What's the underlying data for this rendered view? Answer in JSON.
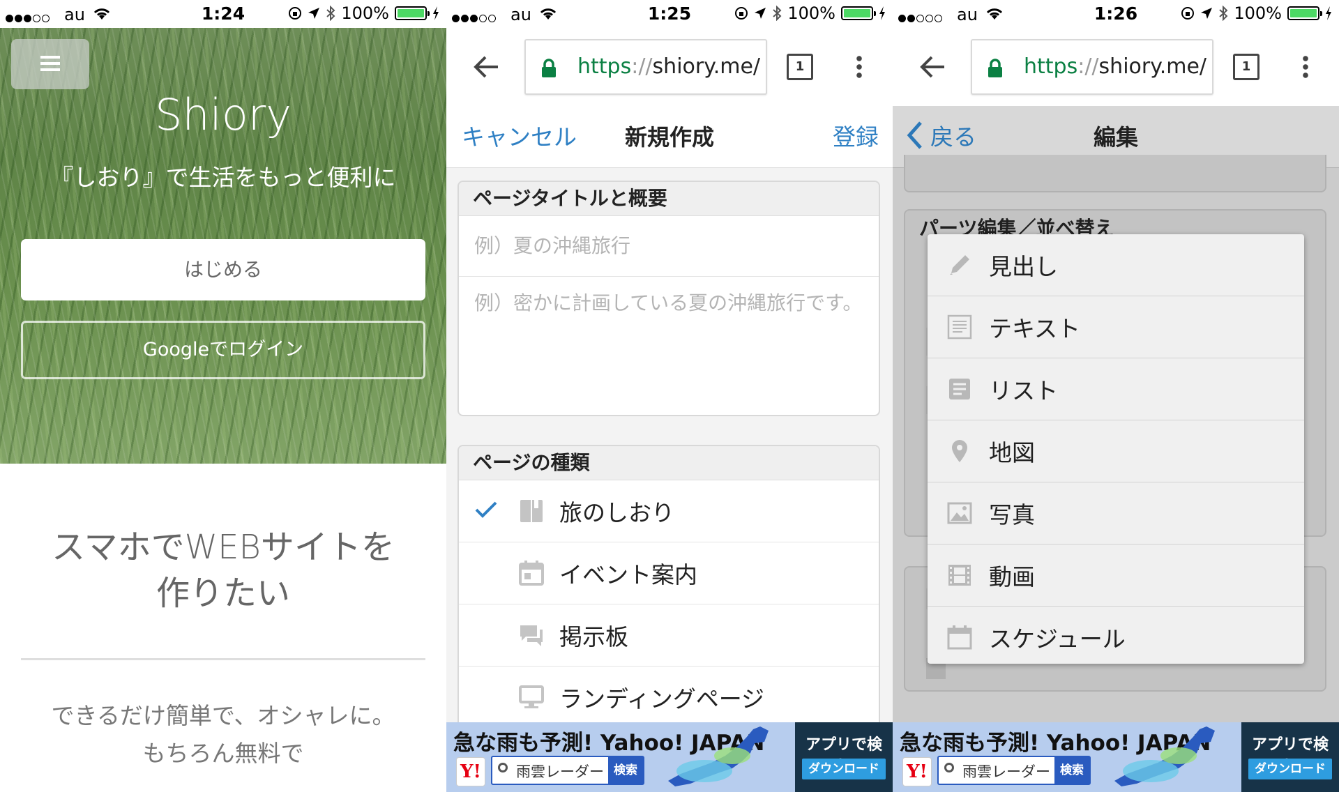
{
  "status_bars": [
    {
      "carrier": "au",
      "time": "1:24",
      "battery": "100%"
    },
    {
      "carrier": "au",
      "time": "1:25",
      "battery": "100%"
    },
    {
      "carrier": "au",
      "time": "1:26",
      "battery": "100%"
    }
  ],
  "landing": {
    "brand": "Shiory",
    "tagline": "『しおり』で生活をもっと便利に",
    "start_button": "はじめる",
    "google_button": "Googleでログイン",
    "heading_line1": "スマホでWEBサイトを",
    "heading_line2": "作りたい",
    "sub_line1": "できるだけ簡単で、オシャレに。",
    "sub_line2": "もちろん無料で"
  },
  "browser": {
    "url_scheme": "https",
    "url_sep": "://",
    "url_host": "shiory.me/",
    "tab_count": "1"
  },
  "create": {
    "cancel": "キャンセル",
    "title": "新規作成",
    "submit": "登録",
    "section_title": "ページタイトルと概要",
    "title_placeholder": "例）夏の沖縄旅行",
    "summary_placeholder": "例）密かに計画している夏の沖縄旅行です。",
    "section_types": "ページの種類",
    "types": [
      {
        "label": "旅のしおり",
        "icon": "book-icon",
        "selected": true
      },
      {
        "label": "イベント案内",
        "icon": "calendar-icon",
        "selected": false
      },
      {
        "label": "掲示板",
        "icon": "chat-icon",
        "selected": false
      },
      {
        "label": "ランディングページ",
        "icon": "monitor-icon",
        "selected": false
      }
    ]
  },
  "edit": {
    "back": "戻る",
    "title": "編集",
    "section_title": "パーツ編集／並べ替え",
    "menu": [
      {
        "label": "見出し",
        "icon": "pencil-icon"
      },
      {
        "label": "テキスト",
        "icon": "text-document-icon"
      },
      {
        "label": "リスト",
        "icon": "list-icon"
      },
      {
        "label": "地図",
        "icon": "map-pin-icon"
      },
      {
        "label": "写真",
        "icon": "image-icon"
      },
      {
        "label": "動画",
        "icon": "film-icon"
      },
      {
        "label": "スケジュール",
        "icon": "calendar-icon"
      }
    ]
  },
  "ad": {
    "headline": "急な雨も予測! Yahoo! JAPAN",
    "logo": "Y!",
    "search_text": "雨雲レーダー",
    "search_button": "検索",
    "cta_title": "アプリで検索!",
    "cta_button": "ダウンロード"
  },
  "colors": {
    "link_blue": "#2f80c4",
    "secure_green": "#0b8043",
    "battery_green": "#4cd964"
  }
}
